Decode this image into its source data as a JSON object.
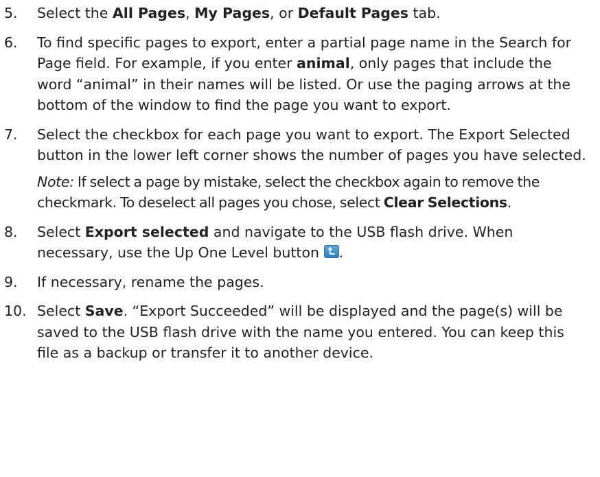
{
  "steps": [
    {
      "number": "5.",
      "parts": {
        "t1": "Select the ",
        "b1": "All Pages",
        "t2": ", ",
        "b2": "My Pages",
        "t3": ", or ",
        "b3": "Default Pages",
        "t4": " tab."
      }
    },
    {
      "number": "6.",
      "parts": {
        "t1": "To find specific pages to export, enter a partial page name in the Search for Page field. For example, if you enter ",
        "b1": "animal",
        "t2": ", only pages that include the word “animal” in their names will be listed. Or use the paging arrows at the bottom of the window to find the page you want to export."
      }
    },
    {
      "number": "7.",
      "parts": {
        "t1": "Select the checkbox for each page you want to export. The Export Selected button in the lower left corner shows the number of pages you have selected."
      },
      "note": {
        "label": "Note:",
        "t1": " If select a page by mistake, select the checkbox again to remove the checkmark. To deselect all pages you chose, select ",
        "b1": "Clear Selections",
        "t2": "."
      }
    },
    {
      "number": "8.",
      "parts": {
        "t1": "Select ",
        "b1": "Export selected",
        "t2": " and navigate to the USB flash drive. When necessary, use the Up One Level button ",
        "t3": "."
      },
      "icon": "up-one-level-icon"
    },
    {
      "number": "9.",
      "parts": {
        "t1": "If necessary, rename the pages."
      }
    },
    {
      "number": "10.",
      "parts": {
        "t1": "Select ",
        "b1": "Save",
        "t2": ". “Export Succeeded” will be displayed and the page(s) will be saved to the USB flash drive with the name you entered. You can keep this file as a backup or transfer it to another device."
      }
    }
  ],
  "colors": {
    "text": "#222222",
    "icon_fill": "#3b8ccc"
  }
}
